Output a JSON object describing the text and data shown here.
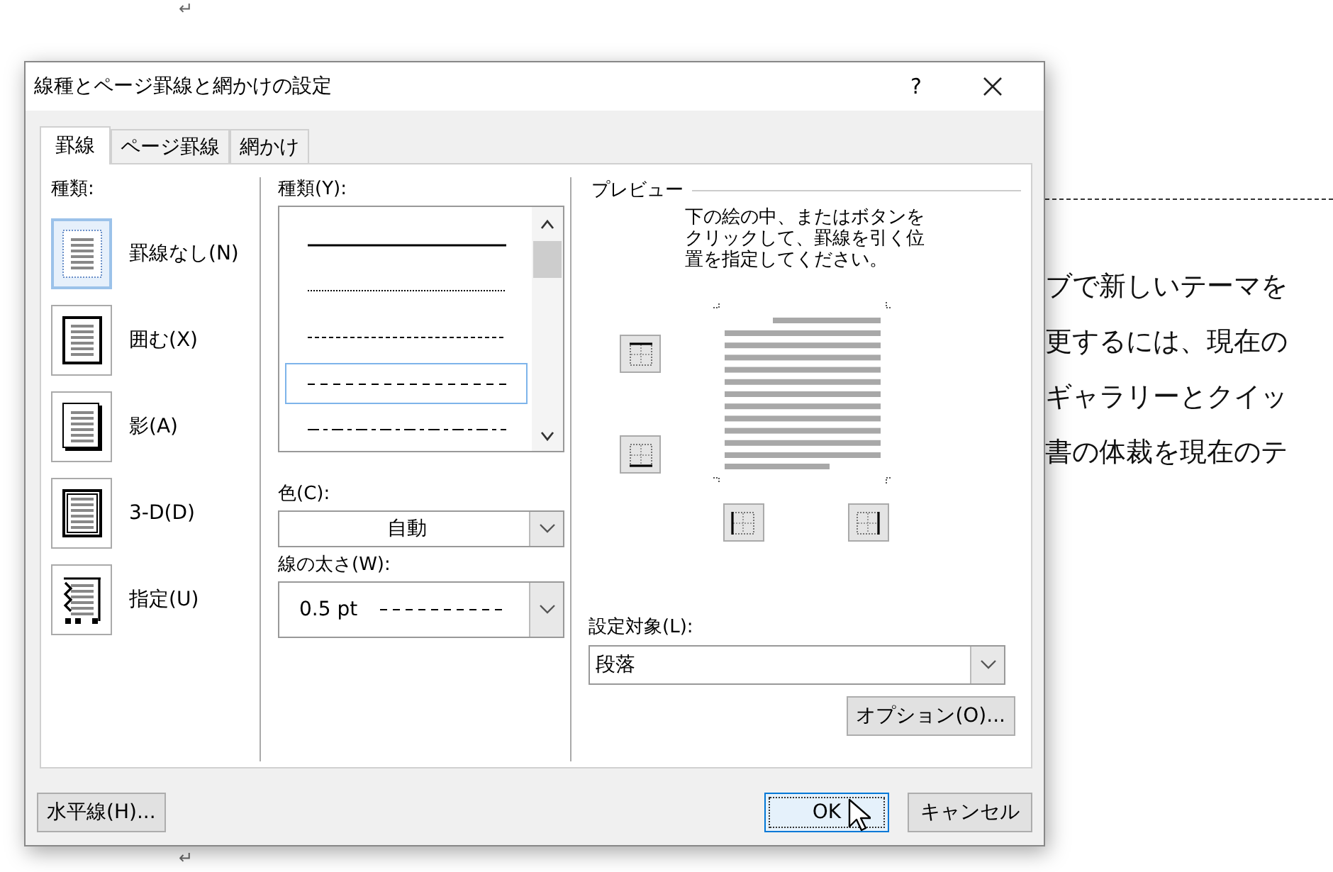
{
  "document": {
    "lines": [
      "ブで新しいテーマを",
      "更するには、現在の",
      "ギャラリーとクイッ",
      "書の体裁を現在のテ"
    ],
    "paragraph_marks": [
      "↵",
      "↵"
    ]
  },
  "dialog": {
    "title": "線種とページ罫線と網かけの設定",
    "help": "?",
    "tabs": [
      {
        "label": "罫線",
        "selected": true
      },
      {
        "label": "ページ罫線",
        "selected": false
      },
      {
        "label": "網かけ",
        "selected": false
      }
    ],
    "setting": {
      "label": "種類:",
      "items": [
        {
          "kind": "none",
          "label": "罫線なし(N)",
          "selected": true
        },
        {
          "kind": "box",
          "label": "囲む(X)",
          "selected": false
        },
        {
          "kind": "shadow",
          "label": "影(A)",
          "selected": false
        },
        {
          "kind": "raised",
          "label": "3-D(D)",
          "selected": false
        },
        {
          "kind": "custom",
          "label": "指定(U)",
          "selected": false
        }
      ]
    },
    "style": {
      "label": "種類(Y):",
      "lines": [
        {
          "kind": "solid",
          "selected": false
        },
        {
          "kind": "dotted",
          "selected": false
        },
        {
          "kind": "dashed-fine",
          "selected": false
        },
        {
          "kind": "dashed",
          "selected": true
        },
        {
          "kind": "dash-dot",
          "selected": false
        }
      ]
    },
    "color": {
      "label": "色(C):",
      "value": "自動"
    },
    "width": {
      "label": "線の太さ(W):",
      "value": "0.5 pt"
    },
    "preview": {
      "title": "プレビュー",
      "instruction": [
        "下の絵の中、またはボタンを",
        "クリックして、罫線を引く位",
        "置を指定してください。"
      ],
      "border_buttons": [
        {
          "kind": "top"
        },
        {
          "kind": "bottom"
        },
        {
          "kind": "left"
        },
        {
          "kind": "right"
        }
      ]
    },
    "apply_to": {
      "label": "設定対象(L):",
      "value": "段落"
    },
    "options_button": "オプション(O)...",
    "horizontal_line_button": "水平線(H)...",
    "buttons": [
      {
        "label": "OK",
        "focused": true
      },
      {
        "label": "キャンセル",
        "focused": false
      }
    ]
  }
}
